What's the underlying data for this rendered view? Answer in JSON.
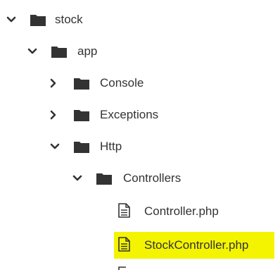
{
  "tree": {
    "items": [
      {
        "label": "stock",
        "icon": "folder-icon",
        "expanded": true
      },
      {
        "label": "app",
        "icon": "folder-icon",
        "expanded": true
      },
      {
        "label": "Console",
        "icon": "folder-icon",
        "expanded": false
      },
      {
        "label": "Exceptions",
        "icon": "folder-icon",
        "expanded": false
      },
      {
        "label": "Http",
        "icon": "folder-icon",
        "expanded": true
      },
      {
        "label": "Controllers",
        "icon": "folder-icon",
        "expanded": true
      },
      {
        "label": "Controller.php",
        "icon": "file-icon"
      },
      {
        "label": "StockController.php",
        "icon": "file-icon",
        "highlighted": true
      }
    ]
  },
  "colors": {
    "highlight": "#f4f400",
    "icon": "#333333",
    "text": "#333333"
  }
}
